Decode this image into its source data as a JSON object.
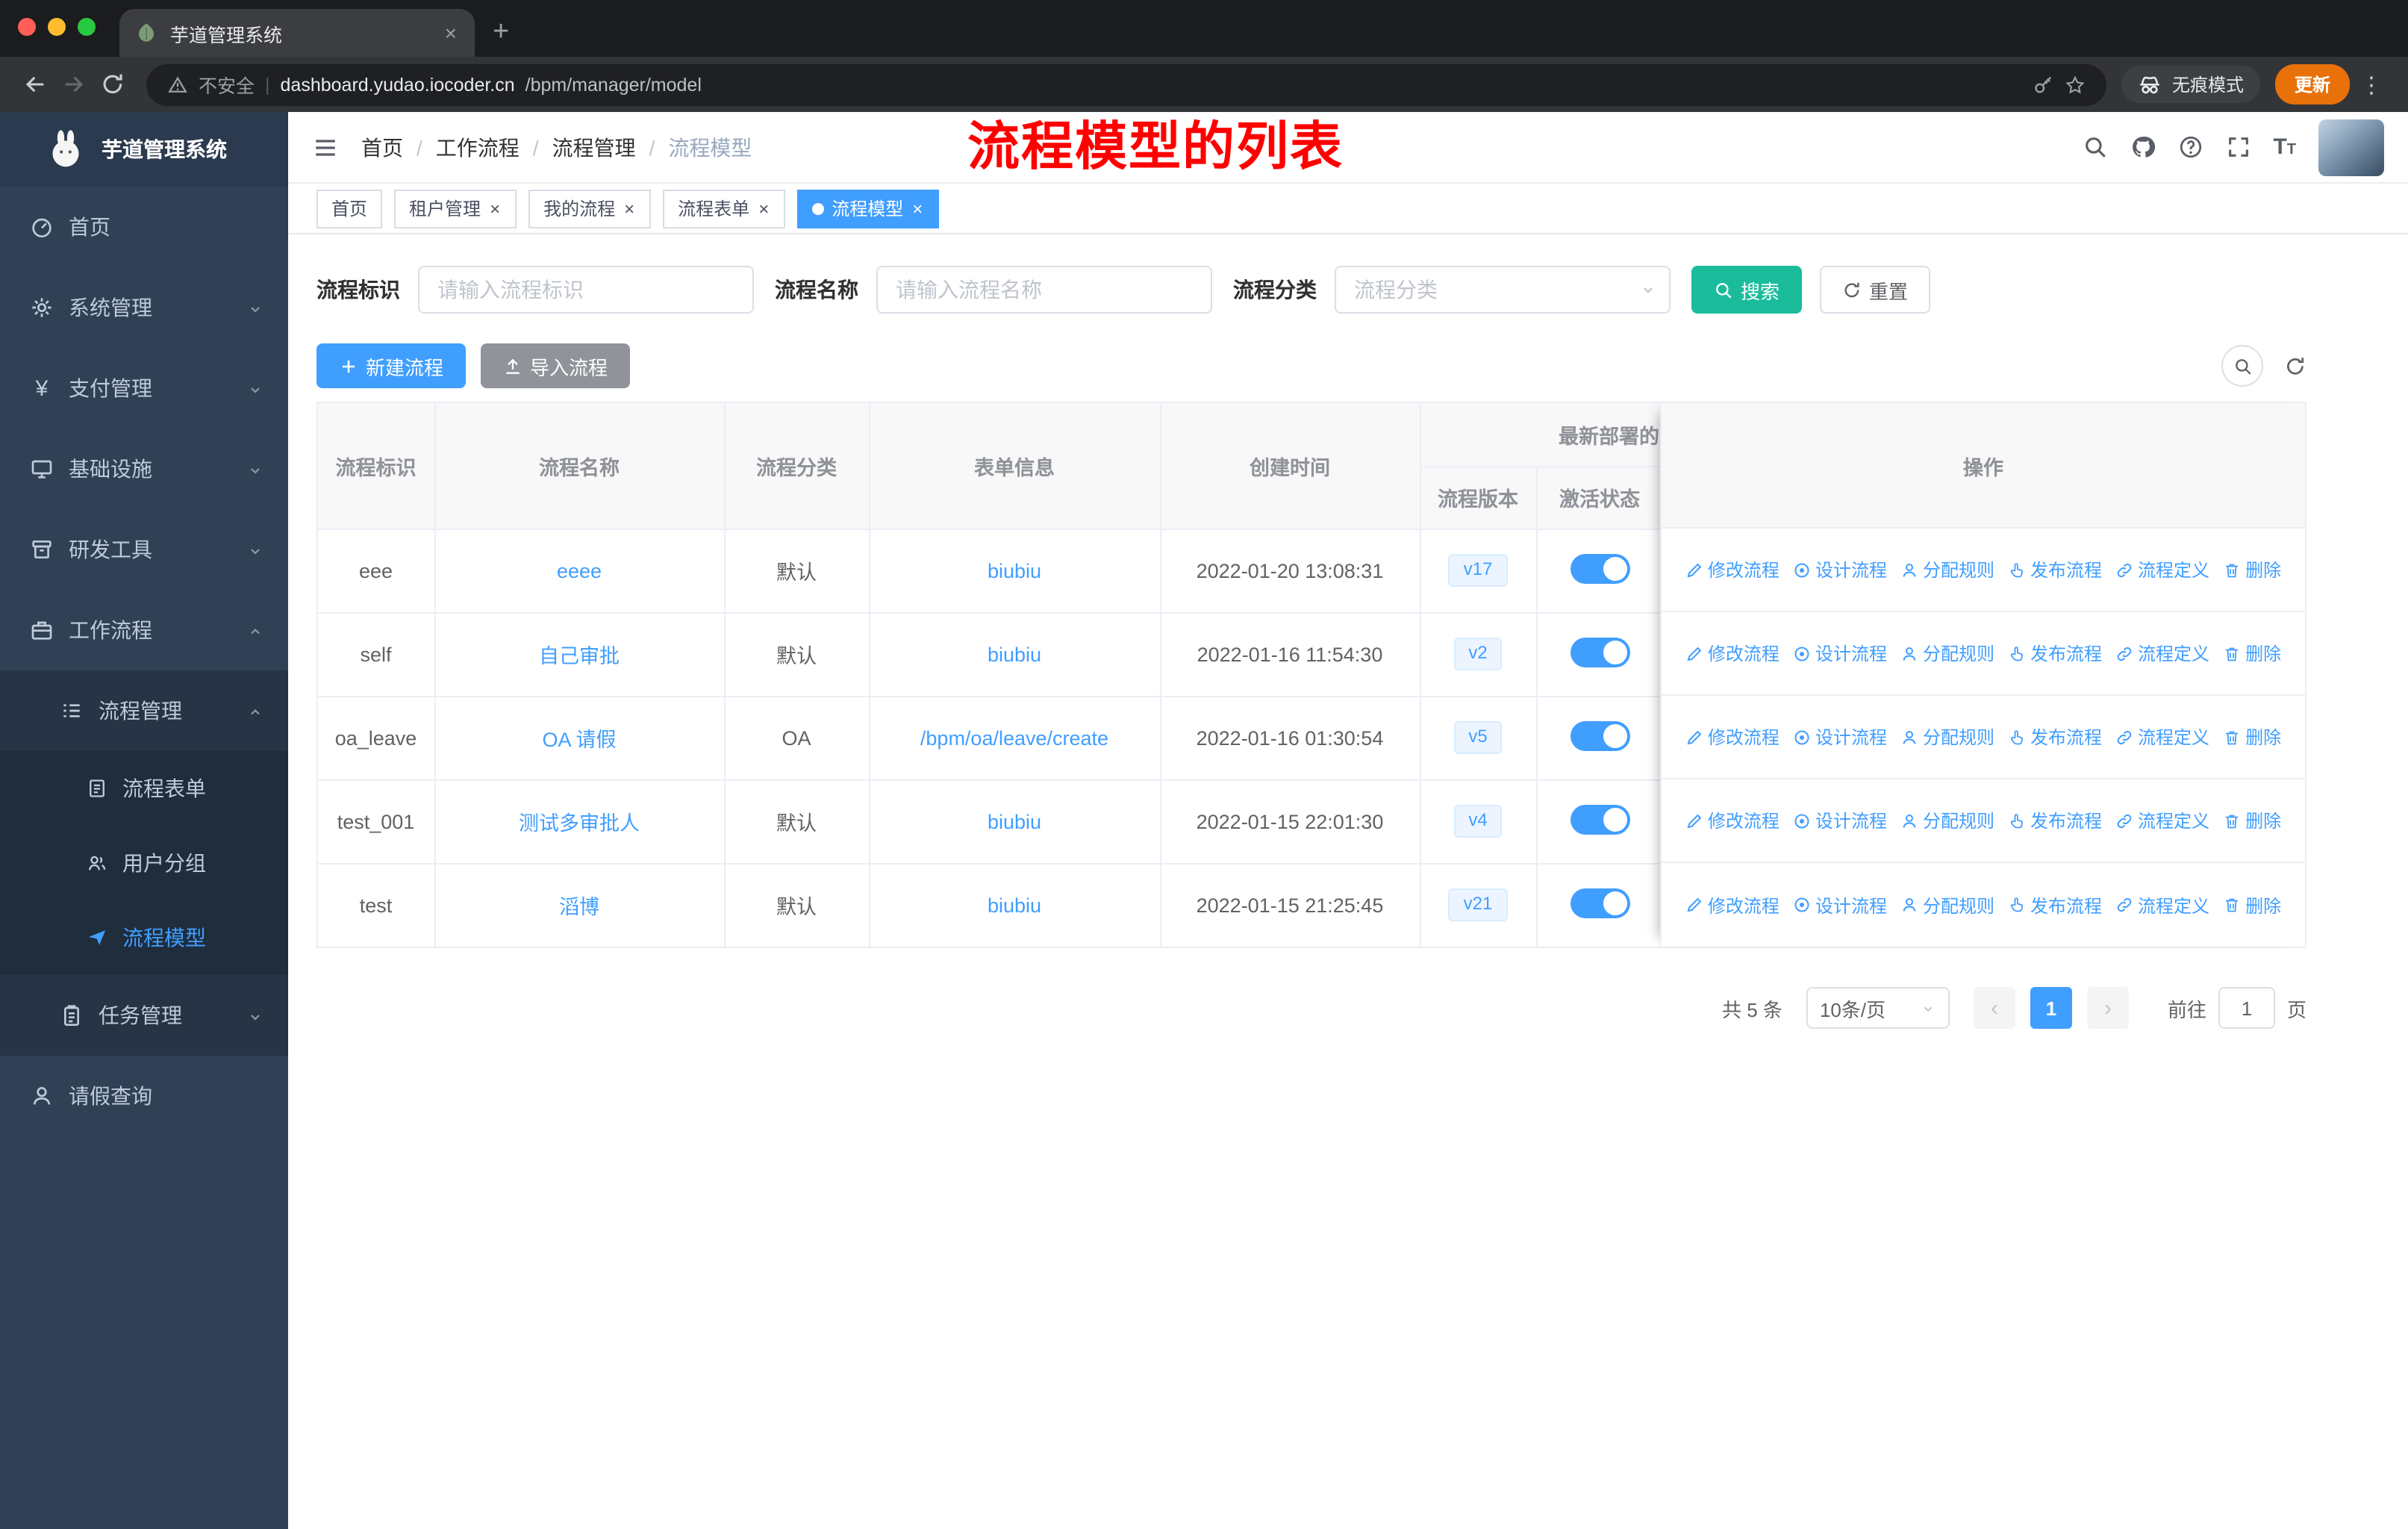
{
  "ui": {
    "close_glyph": "×",
    "plus_glyph": "+",
    "menu_glyph": "⋮",
    "breadcrumb_separator": "/",
    "font_glyph": "T",
    "yen_glyph": "¥"
  },
  "browser": {
    "tab_title": "芋道管理系统",
    "security_text": "不安全",
    "url_domain": "dashboard.yudao.iocoder.cn",
    "url_path": "/bpm/manager/model",
    "incognito_label": "无痕模式",
    "update_label": "更新"
  },
  "sidebar": {
    "app_title": "芋道管理系统",
    "menu": [
      {
        "label": "首页"
      },
      {
        "label": "系统管理"
      },
      {
        "label": "支付管理"
      },
      {
        "label": "基础设施"
      },
      {
        "label": "研发工具"
      },
      {
        "label": "工作流程"
      },
      {
        "label": "流程管理"
      },
      {
        "label": "流程表单"
      },
      {
        "label": "用户分组"
      },
      {
        "label": "流程模型"
      },
      {
        "label": "任务管理"
      },
      {
        "label": "请假查询"
      }
    ]
  },
  "header": {
    "breadcrumb": [
      "首页",
      "工作流程",
      "流程管理",
      "流程模型"
    ]
  },
  "annotation": {
    "text": "流程模型的列表"
  },
  "tags": [
    {
      "label": "首页"
    },
    {
      "label": "租户管理"
    },
    {
      "label": "我的流程"
    },
    {
      "label": "流程表单"
    },
    {
      "label": "流程模型"
    }
  ],
  "filters": {
    "key_label": "流程标识",
    "key_placeholder": "请输入流程标识",
    "name_label": "流程名称",
    "name_placeholder": "请输入流程名称",
    "category_label": "流程分类",
    "category_placeholder": "流程分类",
    "search_label": "搜索",
    "reset_label": "重置"
  },
  "toolbar": {
    "create_label": "新建流程",
    "import_label": "导入流程"
  },
  "table": {
    "headers": {
      "key": "流程标识",
      "name": "流程名称",
      "category": "流程分类",
      "form": "表单信息",
      "created": "创建时间",
      "deploy_group": "最新部署的",
      "version": "流程版本",
      "active": "激活状态",
      "actions": "操作"
    },
    "op_labels": [
      "修改流程",
      "设计流程",
      "分配规则",
      "发布流程",
      "流程定义",
      "删除"
    ],
    "rows": [
      {
        "key": "eee",
        "name": "eeee",
        "category": "默认",
        "form": "biubiu",
        "created": "2022-01-20 13:08:31",
        "version": "v17"
      },
      {
        "key": "self",
        "name": "自己审批",
        "category": "默认",
        "form": "biubiu",
        "created": "2022-01-16 11:54:30",
        "version": "v2"
      },
      {
        "key": "oa_leave",
        "name": "OA 请假",
        "category": "OA",
        "form": "/bpm/oa/leave/create",
        "created": "2022-01-16 01:30:54",
        "version": "v5"
      },
      {
        "key": "test_001",
        "name": "测试多审批人",
        "category": "默认",
        "form": "biubiu",
        "created": "2022-01-15 22:01:30",
        "version": "v4"
      },
      {
        "key": "test",
        "name": "滔博",
        "category": "默认",
        "form": "biubiu",
        "created": "2022-01-15 21:25:45",
        "version": "v21"
      }
    ]
  },
  "pagination": {
    "total_text": "共 5 条",
    "page_size": "10条/页",
    "prev_glyph": "‹",
    "next_glyph": "›",
    "current_page": "1",
    "goto_label": "前往",
    "goto_value": "1",
    "page_unit": "页"
  },
  "colors": {
    "primary": "#409eff",
    "search_button": "#1abc9c",
    "annotation_red": "#ff0000",
    "sidebar_bg": "#304156",
    "submenu_bg": "#1f2d3d"
  }
}
